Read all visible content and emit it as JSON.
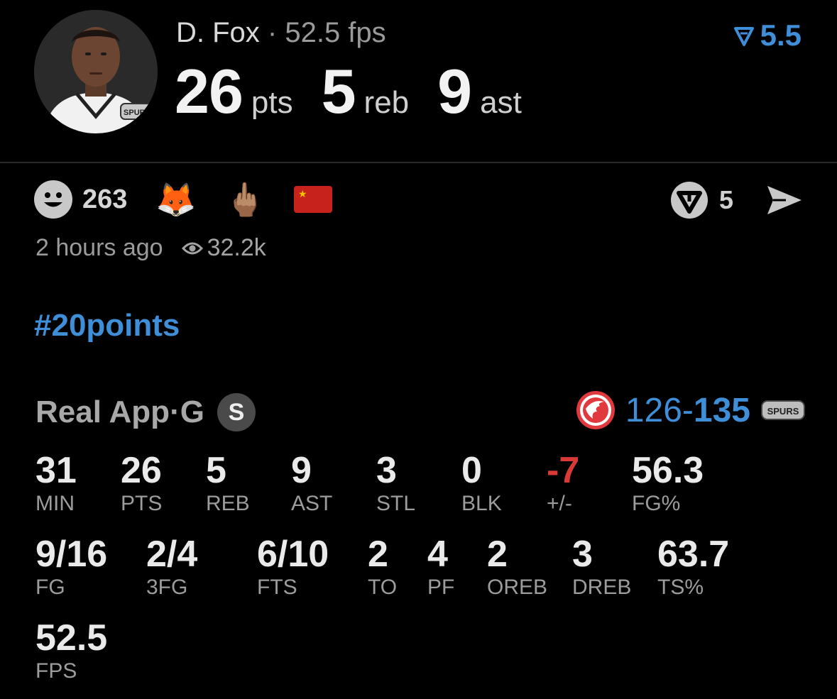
{
  "header": {
    "player": "D. Fox",
    "separator": " · ",
    "fps_text": "52.5 fps",
    "vote_value": "5.5",
    "stats": [
      {
        "value": "26",
        "unit": "pts"
      },
      {
        "value": "5",
        "unit": "reb"
      },
      {
        "value": "9",
        "unit": "ast"
      }
    ],
    "avatar_icon": "player-headshot",
    "team_logo_text": "SPURS"
  },
  "reactions": {
    "smile_count": "263",
    "emojis": [
      "🦊",
      "🖕🏽"
    ],
    "flag": "china-flag",
    "comment_count": "5"
  },
  "meta": {
    "time": "2 hours ago",
    "views": "32.2k"
  },
  "hashtag": "#20points",
  "game": {
    "source": "Real App",
    "sep": " · ",
    "position": "G",
    "badge": "S",
    "score_left": "126",
    "score_dash": "-",
    "score_right": "135",
    "opponent_logo": "hawks-logo",
    "team_logo": "spurs-logo",
    "team_logo_text": "SPURS"
  },
  "boxscore": {
    "row1": [
      {
        "v": "31",
        "l": "MIN"
      },
      {
        "v": "26",
        "l": "PTS"
      },
      {
        "v": "5",
        "l": "REB"
      },
      {
        "v": "9",
        "l": "AST"
      },
      {
        "v": "3",
        "l": "STL"
      },
      {
        "v": "0",
        "l": "BLK"
      },
      {
        "v": "-7",
        "l": "+/-"
      },
      {
        "v": "56.3",
        "l": "FG%"
      }
    ],
    "row2": [
      {
        "v": "9/16",
        "l": "FG"
      },
      {
        "v": "2/4",
        "l": "3FG"
      },
      {
        "v": "6/10",
        "l": "FTS"
      },
      {
        "v": "2",
        "l": "TO"
      },
      {
        "v": "4",
        "l": "PF"
      },
      {
        "v": "2",
        "l": "OREB"
      },
      {
        "v": "3",
        "l": "DREB"
      },
      {
        "v": "63.7",
        "l": "TS%"
      }
    ],
    "row3": [
      {
        "v": "52.5",
        "l": "FPS"
      }
    ]
  },
  "colors": {
    "accent": "#3e8ed8",
    "negative": "#d93a35",
    "background": "#000000"
  }
}
